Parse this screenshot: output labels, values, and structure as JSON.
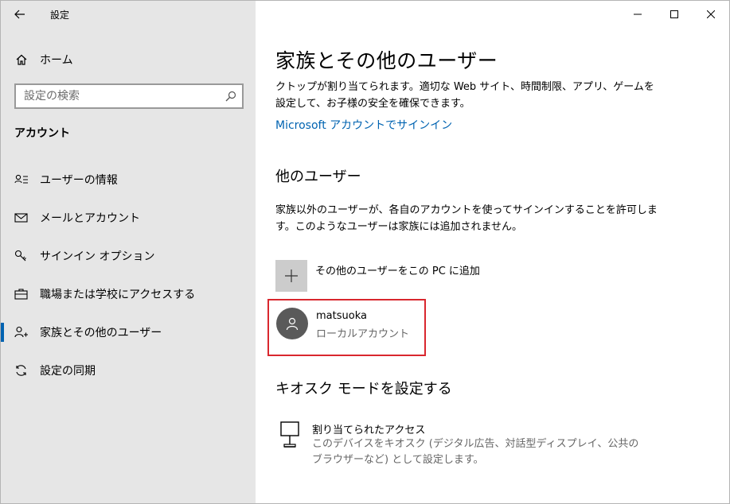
{
  "app": {
    "title": "設定"
  },
  "sidebar": {
    "home_label": "ホーム",
    "search_placeholder": "設定の検索",
    "section_title": "アカウント",
    "items": [
      {
        "label": "ユーザーの情報",
        "icon": "user-info-icon",
        "selected": false
      },
      {
        "label": "メールとアカウント",
        "icon": "mail-icon",
        "selected": false
      },
      {
        "label": "サインイン オプション",
        "icon": "key-icon",
        "selected": false
      },
      {
        "label": "職場または学校にアクセスする",
        "icon": "briefcase-icon",
        "selected": false
      },
      {
        "label": "家族とその他のユーザー",
        "icon": "person-add-icon",
        "selected": true
      },
      {
        "label": "設定の同期",
        "icon": "sync-icon",
        "selected": false
      }
    ]
  },
  "main": {
    "title": "家族とその他のユーザー",
    "family_desc_line1": "クトップが割り当てられます。適切な Web サイト、時間制限、アプリ、ゲームを",
    "family_desc_line2": "設定して、お子様の安全を確保できます。",
    "signin_link": "Microsoft アカウントでサインイン",
    "other_users": {
      "title": "他のユーザー",
      "desc_line1": "家族以外のユーザーが、各自のアカウントを使ってサインインすることを許可しま",
      "desc_line2": "す。このようなユーザーは家族には追加されません。",
      "add_label": "その他のユーザーをこの PC に追加",
      "user": {
        "name": "matsuoka",
        "type": "ローカルアカウント"
      }
    },
    "kiosk": {
      "title": "キオスク モードを設定する",
      "item_title": "割り当てられたアクセス",
      "item_desc_line1": "このデバイスをキオスク (デジタル広告、対話型ディスプレイ、公共の",
      "item_desc_line2": "ブラウザーなど) として設定します。"
    }
  },
  "colors": {
    "accent": "#0063b1",
    "highlight_border": "#d9272e",
    "sidebar_bg": "#e6e6e6"
  }
}
